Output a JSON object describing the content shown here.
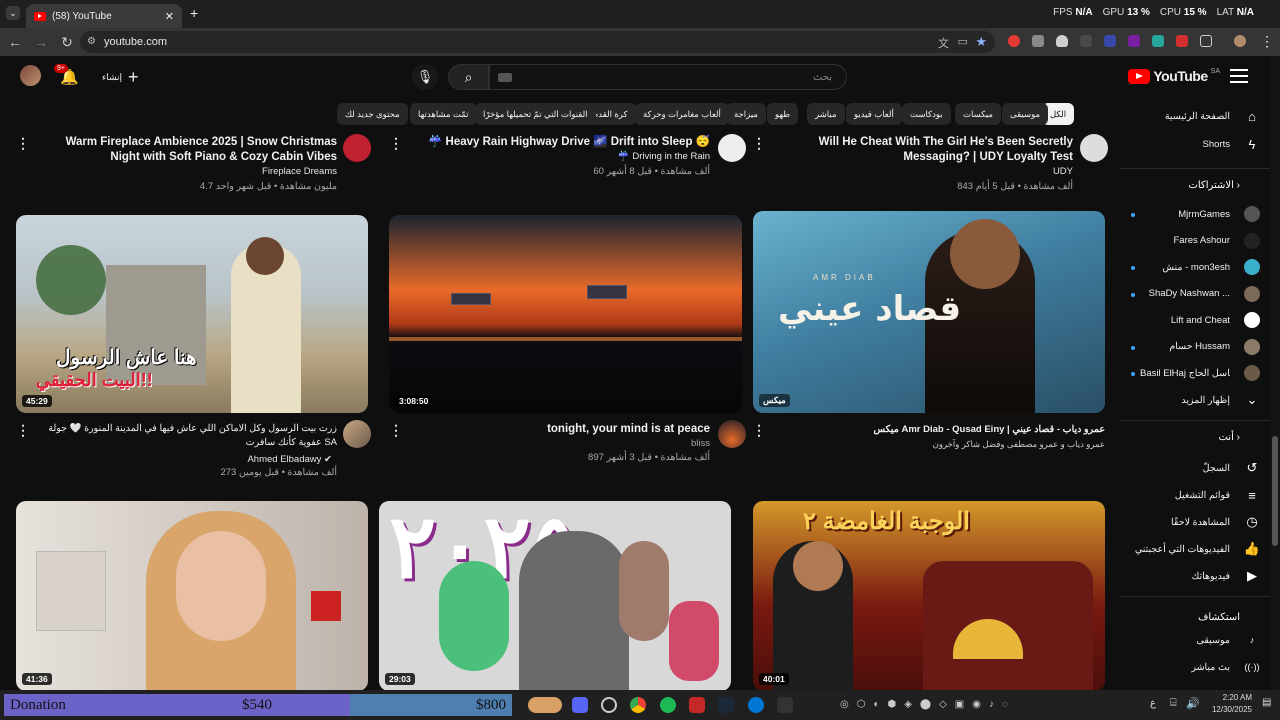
{
  "browser": {
    "tab_title": "(58) YouTube",
    "new_tab": "+",
    "url": "youtube.com",
    "perf": {
      "fps_label": "FPS",
      "fps": "N/A",
      "gpu_label": "GPU",
      "gpu": "13 %",
      "cpu_label": "CPU",
      "cpu": "15 %",
      "lat_label": "LAT",
      "lat": "N/A"
    }
  },
  "header": {
    "logo": "YouTube",
    "region": "SA",
    "search_placeholder": "بحث",
    "create_label": "إنشاء",
    "notif_count": "9+"
  },
  "chips": [
    "الكل",
    "موسيقى",
    "ميكسات",
    "بودكاست",
    "ألعاب فيديو",
    "مباشر",
    "طهو",
    "ميزاجة",
    "ألعاب مغامرات وحركة",
    "كرة القدم",
    "القنوات التي تمّ تحميلها مؤخرًا",
    "تمّت مشاهدتها",
    "محتوى جديد لك"
  ],
  "sidebar": {
    "home": "الصفحة الرئيسية",
    "shorts": "Shorts",
    "subs_head": "الاشتراكات",
    "subs": [
      "MjrmGames",
      "Fares Ashour",
      "منش - mon3esh",
      "ShaDy Nashwan ...",
      "Lift and Cheat",
      "حسام Hussam",
      "Basil ElHaj باسل الحاج"
    ],
    "show_more": "إظهار المزيد",
    "you_head": "أنت",
    "you_items": [
      "السجلّ",
      "قوائم التشغيل",
      "المشاهدة لاحقًا",
      "الفيديوهات التي أعجبتني",
      "فيديوهاتك"
    ],
    "explore_head": "استكشاف",
    "explore_items": [
      "موسيقى",
      "بث مباشر"
    ]
  },
  "top_row": [
    {
      "title": "Will He Cheat With The Girl He's Been Secretly Messaging? | UDY Loyalty Test",
      "channel": "UDY",
      "meta": "843 ألف مشاهدة • قبل 5 أيام"
    },
    {
      "title": "☔ Heavy Rain Highway Drive 🌌 Drift into Sleep 😴",
      "channel": "☔ Driving in the Rain",
      "meta": "60 ألف مشاهدة • قبل 8 أشهر"
    },
    {
      "title": "Warm Fireplace Ambience 2025 | Snow Christmas Night with Soft Piano & Cozy Cabin Vibes",
      "channel": "Fireplace Dreams",
      "meta": "4.7 مليون مشاهدة • قبل شهر واحد"
    }
  ],
  "mid_row": [
    {
      "title": "ميكس Amr Diab - Qusad Einy | عمرو دياب - قصاد عيني",
      "channel": "عمرو دياب و عمرو مصطفى وفضل شاكر وآخرون",
      "meta": "",
      "duration": "ميكس",
      "thumb_text": "قصاد عيني",
      "thumb_sub": "AMR DIAB"
    },
    {
      "title": "tonight, your mind is at peace",
      "channel": "bliss",
      "meta": "897 ألف مشاهدة • قبل 3 أشهر",
      "duration": "3:08:50"
    },
    {
      "title": "زرت بيت الرسول وكل الاماكن اللي عاش فيها في المدينة المنورة 🤍 جولة عفوية كأنك سافرت SA",
      "channel": "Ahmed Elbadawy",
      "meta": "273 ألف مشاهدة • قبل يومين",
      "duration": "45:29",
      "thumb_text": "هنا عاش الرسول",
      "thumb_sub": "البيت الحقيقي!!"
    }
  ],
  "bottom_row": [
    {
      "duration": "40:01",
      "thumb_text": "الوجبة الغامضة ٢"
    },
    {
      "duration": "29:03",
      "thumb_text": "٢٠٢٥"
    },
    {
      "duration": "41:36"
    }
  ],
  "taskbar": {
    "donation": "Donation",
    "amount1": "$540",
    "amount2": "$800",
    "time": "2:20 AM",
    "date": "12/30/2025",
    "lang": "ع"
  },
  "colors": {
    "bg": "#0f0f0f",
    "accent": "#ff0000",
    "chip": "#272727",
    "donation": "#6c63c9"
  }
}
